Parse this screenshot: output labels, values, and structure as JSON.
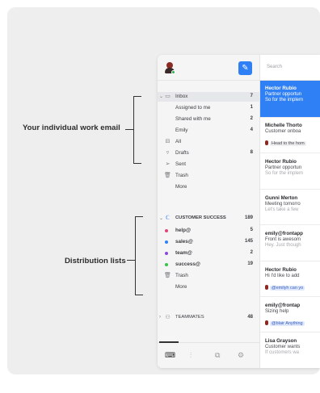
{
  "callouts": {
    "work_email": "Your individual work email",
    "distribution": "Distribution lists"
  },
  "sidebar": {
    "inbox_items": [
      {
        "label": "Inbox",
        "count": "7",
        "icon": "inbox-icon"
      },
      {
        "label": "Assigned to me",
        "count": "1"
      },
      {
        "label": "Shared with me",
        "count": "2"
      },
      {
        "label": "Emily",
        "count": "4"
      },
      {
        "label": "All",
        "count": "",
        "icon": "archive-icon"
      },
      {
        "label": "Drafts",
        "count": "8",
        "icon": "drafts-icon"
      },
      {
        "label": "Sent",
        "count": "",
        "icon": "sent-icon"
      },
      {
        "label": "Trash",
        "count": "",
        "icon": "trash-icon"
      },
      {
        "label": "More",
        "count": ""
      }
    ],
    "team": {
      "label": "CUSTOMER SUCCESS",
      "count": "189",
      "items": [
        {
          "label": "help@",
          "count": "5",
          "color": "#e0457b"
        },
        {
          "label": "sales@",
          "count": "145",
          "color": "#2f7ff5"
        },
        {
          "label": "team@",
          "count": "2",
          "color": "#8a4bd8"
        },
        {
          "label": "success@",
          "count": "19",
          "color": "#39c24a"
        },
        {
          "label": "Trash",
          "count": "",
          "icon": "trash-icon"
        },
        {
          "label": "More",
          "count": ""
        }
      ]
    },
    "teammates": {
      "label": "TEAMMATES",
      "count": "48"
    }
  },
  "search": {
    "placeholder": "Search"
  },
  "conversations": [
    {
      "from": "Hector Rubio",
      "subject": "Partner opportun",
      "preview": "So for the implem",
      "tag": "",
      "active": true
    },
    {
      "from": "Michelle Thorto",
      "subject": "Customer onboa",
      "preview": "",
      "tag": "Head to the hom",
      "active": false
    },
    {
      "from": "Hector Rubio",
      "subject": "Partner opportun",
      "preview": "So for the implem",
      "tag": "",
      "active": false
    },
    {
      "from": "Gunni Merton",
      "subject": "Meeting tomorro",
      "preview": "Let's take a few",
      "tag": "",
      "active": false
    },
    {
      "from": "emily@frontapp",
      "subject": "Front is awesom",
      "preview": "Hey. Just though",
      "tag": "",
      "active": false
    },
    {
      "from": "Hector Rubio",
      "subject": "Hi I'd like to add",
      "preview": "",
      "tag": "@emilyh can yo",
      "active": false
    },
    {
      "from": "emily@frontap",
      "subject": "Sizing help",
      "preview": "",
      "tag": "@blair Anything",
      "active": false
    },
    {
      "from": "Lisa Grayson",
      "subject": "Customer wants",
      "preview": "If customers wa",
      "tag": "",
      "active": false
    }
  ]
}
